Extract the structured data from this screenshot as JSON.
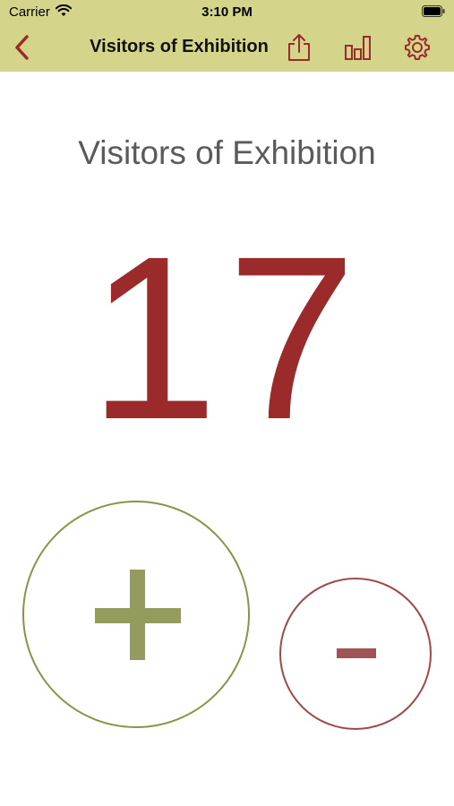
{
  "status_bar": {
    "carrier": "Carrier",
    "time": "3:10 PM"
  },
  "nav": {
    "title": "Visitors of Exhibition",
    "icons": [
      "back-chevron-icon",
      "share-icon",
      "bar-chart-icon",
      "gear-icon"
    ]
  },
  "counter": {
    "title": "Visitors of Exhibition",
    "value": "17"
  },
  "buttons": {
    "increment_icon": "plus-icon",
    "decrement_icon": "minus-icon"
  },
  "colors": {
    "bar_background": "#d4d58a",
    "accent_red": "#9b2a2a",
    "plus_green": "#8c9346",
    "minus_red": "#a14848"
  }
}
